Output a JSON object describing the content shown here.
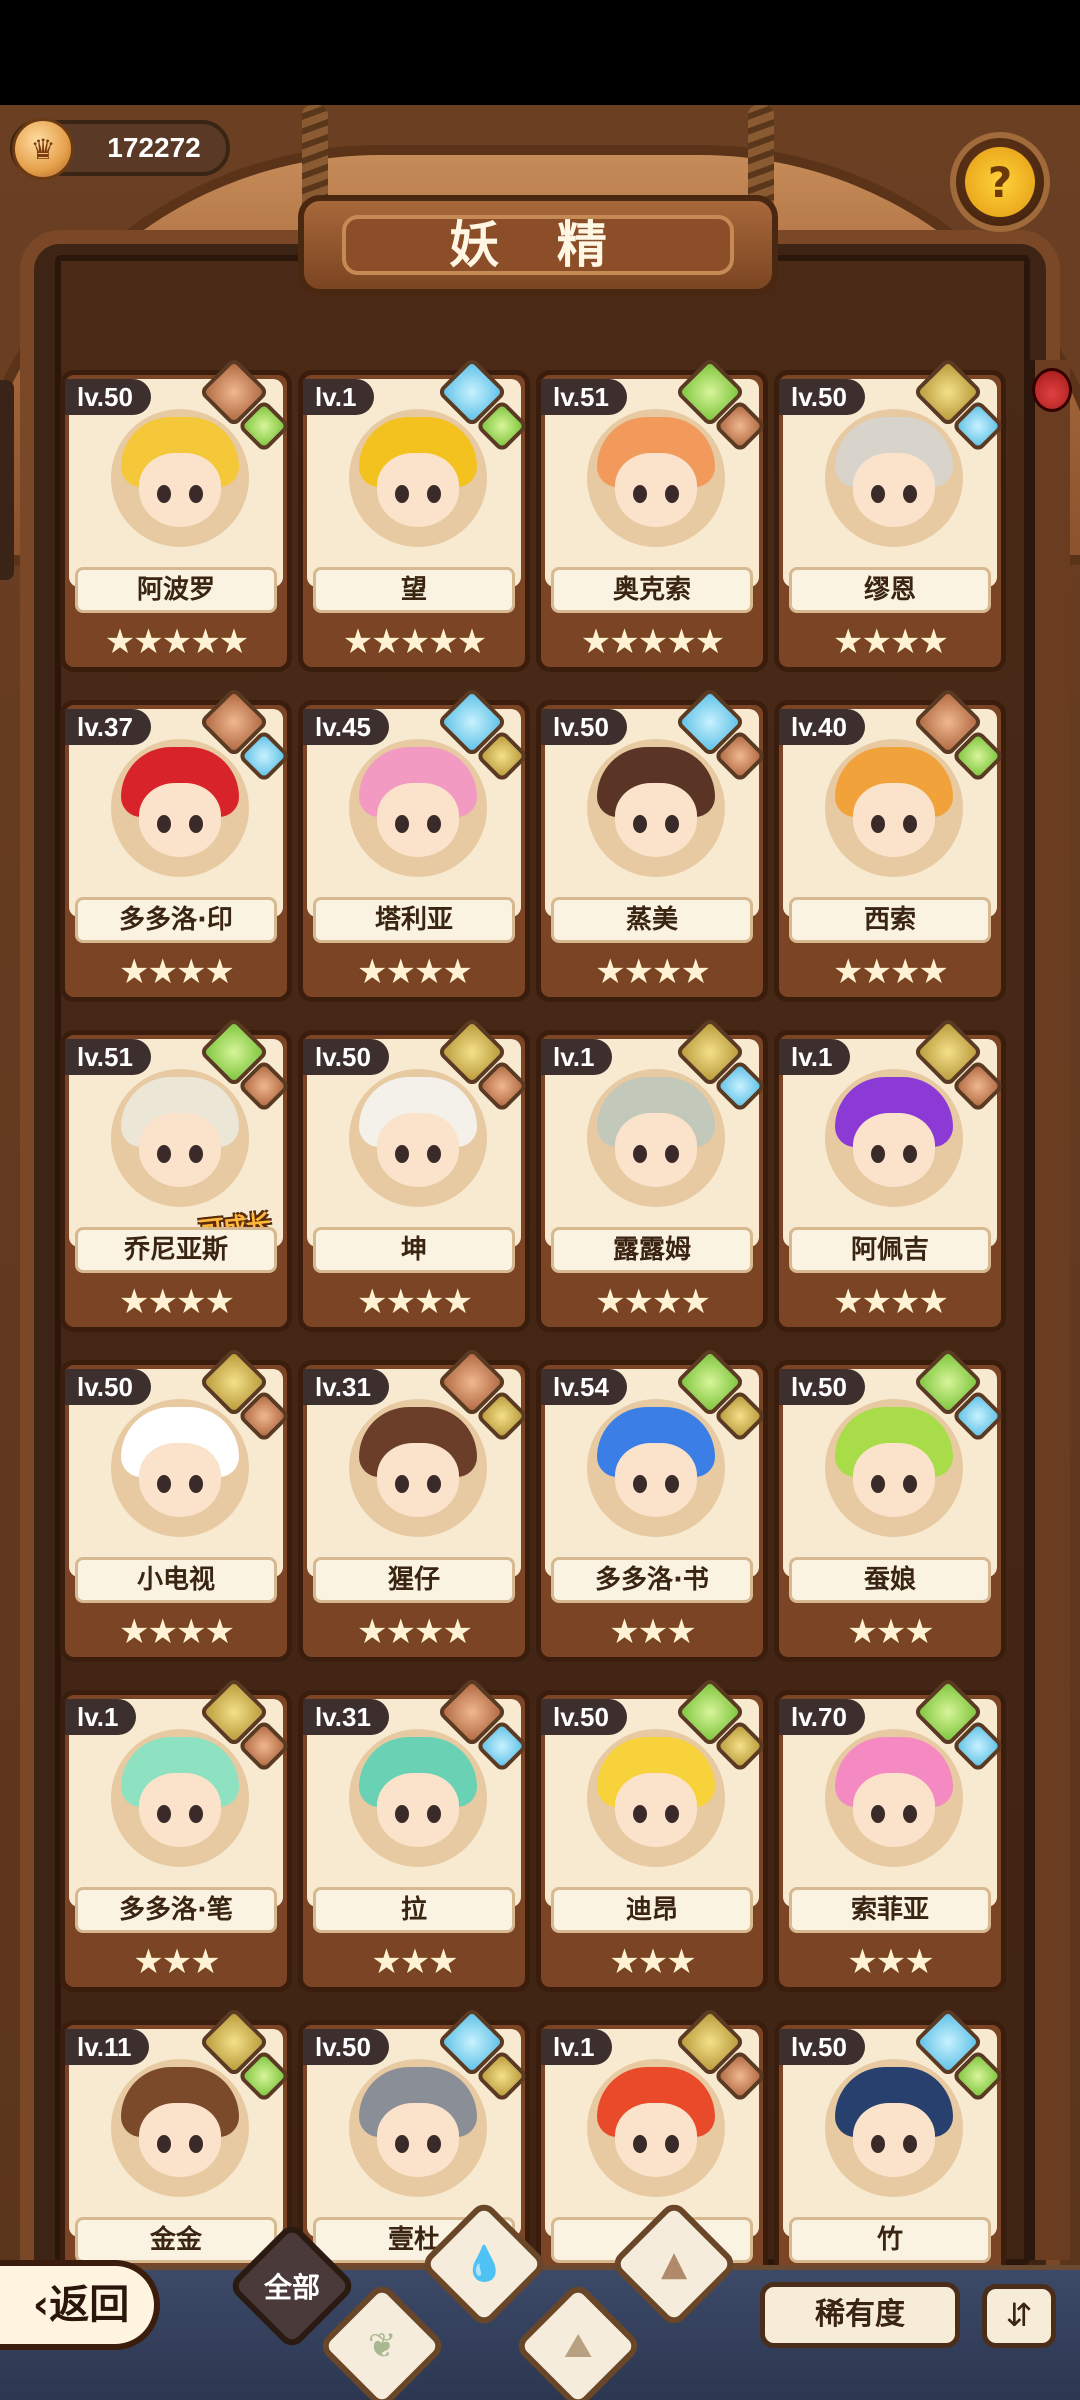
{
  "header": {
    "coins": "172272",
    "title": "妖 精",
    "help_icon": "question-mark-sprout-icon"
  },
  "cards": [
    {
      "level": "lv.50",
      "name": "阿波罗",
      "stars": "★★★★★",
      "hair": "#f5c83a",
      "gems": [
        "fire",
        "leaf"
      ]
    },
    {
      "level": "lv.1",
      "name": "望",
      "stars": "★★★★★",
      "hair": "#f4c21e",
      "gems": [
        "water",
        "leaf"
      ]
    },
    {
      "level": "lv.51",
      "name": "奥克索",
      "stars": "★★★★★",
      "hair": "#f19a5c",
      "gems": [
        "leaf",
        "fire"
      ]
    },
    {
      "level": "lv.50",
      "name": "缪恩",
      "stars": "★★★★",
      "hair": "#d8d4cc",
      "gems": [
        "earth",
        "water"
      ]
    },
    {
      "level": "lv.37",
      "name": "多多洛·印",
      "stars": "★★★★",
      "hair": "#d9232a",
      "gems": [
        "fire",
        "water"
      ]
    },
    {
      "level": "lv.45",
      "name": "塔利亚",
      "stars": "★★★★",
      "hair": "#f29ac2",
      "gems": [
        "water",
        "earth"
      ]
    },
    {
      "level": "lv.50",
      "name": "蒸美",
      "stars": "★★★★",
      "hair": "#5a3424",
      "gems": [
        "water",
        "fire"
      ]
    },
    {
      "level": "lv.40",
      "name": "西索",
      "stars": "★★★★",
      "hair": "#f2a23a",
      "gems": [
        "fire",
        "leaf"
      ]
    },
    {
      "level": "lv.51",
      "name": "乔尼亚斯",
      "stars": "★★★★",
      "hair": "#ece6d6",
      "gems": [
        "leaf",
        "fire"
      ],
      "tag": "可成长"
    },
    {
      "level": "lv.50",
      "name": "坤",
      "stars": "★★★★",
      "hair": "#f4f1ea",
      "gems": [
        "earth",
        "fire"
      ]
    },
    {
      "level": "lv.1",
      "name": "露露姆",
      "stars": "★★★★",
      "hair": "#c2c8ba",
      "gems": [
        "earth",
        "water"
      ]
    },
    {
      "level": "lv.1",
      "name": "阿佩吉",
      "stars": "★★★★",
      "hair": "#8b3ad6",
      "gems": [
        "earth",
        "fire"
      ]
    },
    {
      "level": "lv.50",
      "name": "小电视",
      "stars": "★★★★",
      "hair": "#ffffff",
      "gems": [
        "earth",
        "fire"
      ]
    },
    {
      "level": "lv.31",
      "name": "猩仔",
      "stars": "★★★★",
      "hair": "#6a3e28",
      "gems": [
        "fire",
        "earth"
      ]
    },
    {
      "level": "lv.54",
      "name": "多多洛·书",
      "stars": "★★★",
      "hair": "#3a7ee6",
      "gems": [
        "leaf",
        "earth"
      ]
    },
    {
      "level": "lv.50",
      "name": "蚕娘",
      "stars": "★★★",
      "hair": "#a8dc48",
      "gems": [
        "leaf",
        "water"
      ]
    },
    {
      "level": "lv.1",
      "name": "多多洛·笔",
      "stars": "★★★",
      "hair": "#8ee2c2",
      "gems": [
        "earth",
        "fire"
      ]
    },
    {
      "level": "lv.31",
      "name": "拉",
      "stars": "★★★",
      "hair": "#6ad2b4",
      "gems": [
        "fire",
        "water"
      ]
    },
    {
      "level": "lv.50",
      "name": "迪昂",
      "stars": "★★★",
      "hair": "#f8d23a",
      "gems": [
        "leaf",
        "earth"
      ]
    },
    {
      "level": "lv.70",
      "name": "索菲亚",
      "stars": "★★★",
      "hair": "#f58ac2",
      "gems": [
        "leaf",
        "water"
      ]
    },
    {
      "level": "lv.11",
      "name": "金金",
      "stars": "",
      "hair": "#7a4a2a",
      "gems": [
        "earth",
        "leaf"
      ]
    },
    {
      "level": "lv.50",
      "name": "壹杜",
      "stars": "",
      "hair": "#8a8e96",
      "gems": [
        "water",
        "earth"
      ]
    },
    {
      "level": "lv.1",
      "name": "",
      "stars": "",
      "hair": "#e84a2a",
      "gems": [
        "earth",
        "fire"
      ]
    },
    {
      "level": "lv.50",
      "name": "竹",
      "stars": "",
      "hair": "#27406e",
      "gems": [
        "water",
        "leaf"
      ]
    }
  ],
  "bottom": {
    "back_label": "返回",
    "filter_all_label": "全部",
    "filters": [
      "water-drop-icon",
      "sprout-icon",
      "mountain-icon",
      "earth-icon"
    ],
    "rarity_label": "稀有度",
    "sort_icon": "sort-order-icon"
  },
  "colors": {
    "wood": "#7b4424",
    "card_paper": "#f7ead1",
    "bottom_bar": "#2c3650"
  }
}
